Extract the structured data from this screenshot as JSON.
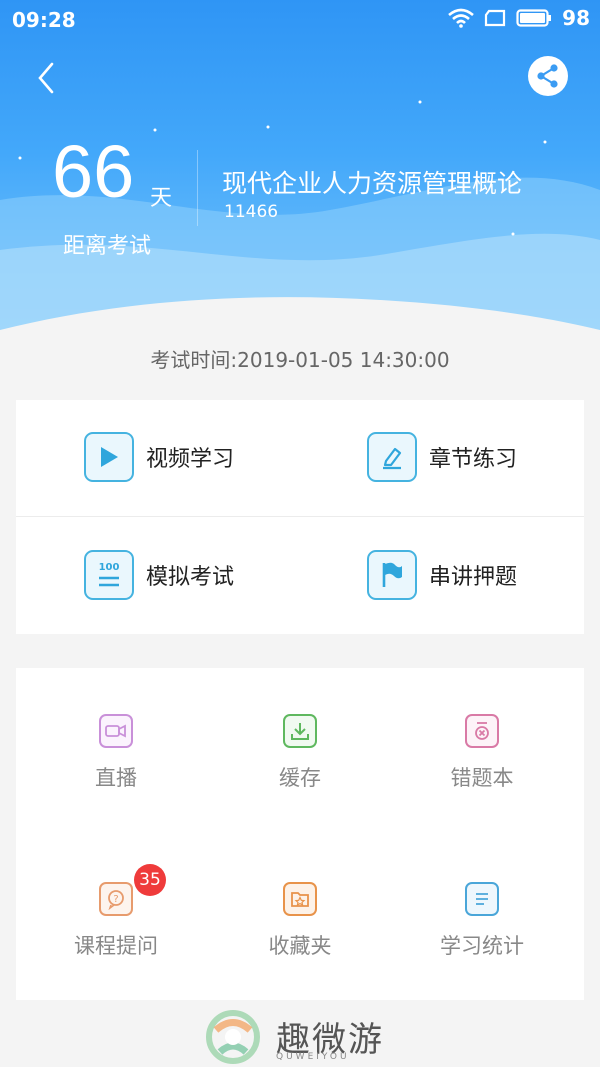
{
  "status_bar": {
    "time": "09:28",
    "battery": "98"
  },
  "header": {
    "days_number": "66",
    "days_unit": "天",
    "countdown_label": "距离考试",
    "course_title": "现代企业人力资源管理概论",
    "course_code": "11466"
  },
  "exam_time": "考试时间:2019-01-05 14:30:00",
  "features": [
    {
      "label": "视频学习",
      "icon": "play-icon"
    },
    {
      "label": "章节练习",
      "icon": "pencil-icon"
    },
    {
      "label": "模拟考试",
      "icon": "exam-paper-icon"
    },
    {
      "label": "串讲押题",
      "icon": "flag-icon"
    }
  ],
  "tools": [
    {
      "label": "直播",
      "icon": "video-camera-icon",
      "color": "#c990d9"
    },
    {
      "label": "缓存",
      "icon": "download-icon",
      "color": "#5fb85f"
    },
    {
      "label": "错题本",
      "icon": "wrong-book-icon",
      "color": "#d97aa6"
    },
    {
      "label": "课程提问",
      "icon": "question-bubble-icon",
      "color": "#e79b6d"
    },
    {
      "label": "收藏夹",
      "icon": "favorite-folder-icon",
      "color": "#e8934a"
    },
    {
      "label": "学习统计",
      "icon": "statistics-icon",
      "color": "#4aa6d9"
    }
  ],
  "question_badge": "35",
  "watermark": {
    "name": "趣微游",
    "sub": "QUWEIYOU"
  }
}
